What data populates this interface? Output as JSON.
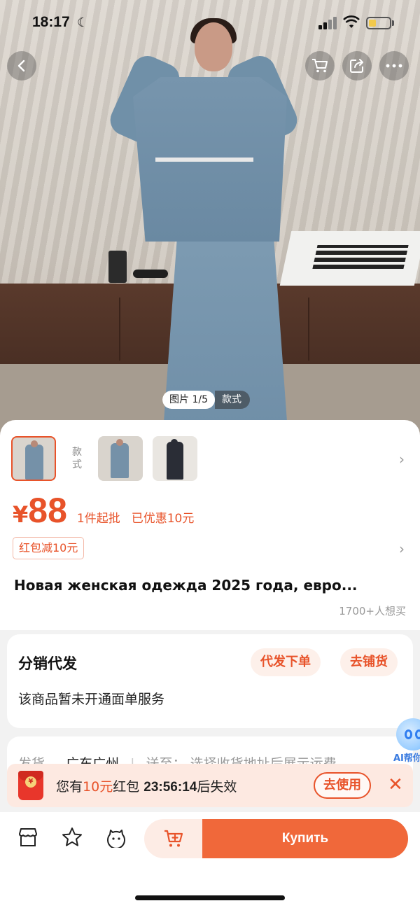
{
  "status_bar": {
    "time": "18:17"
  },
  "gallery": {
    "counter": "图片 1/5",
    "style_tab": "款式"
  },
  "thumbs": {
    "style_label": "款式"
  },
  "price": {
    "currency": "¥",
    "amount": "88",
    "min_order": "1件起批",
    "discount": "已优惠10元"
  },
  "coupon": {
    "label": "红包减10元"
  },
  "product": {
    "title": "Новая женская одежда 2025 года, евро...",
    "wants": "1700+人想买"
  },
  "distribution": {
    "title": "分销代发",
    "action_1": "代发下单",
    "action_2": "去铺货",
    "description": "该商品暂未开通面单服务"
  },
  "shipping": {
    "label": "发货",
    "origin": "广东广州",
    "dest_label": "送至：",
    "dest_hint": "选择收货地址后展示运费"
  },
  "ai_helper": {
    "label": "AI帮你"
  },
  "red_packet": {
    "prefix": "您有",
    "amount": "10元",
    "suffix": "红包",
    "countdown": "23:56:14",
    "expiry": "后失效",
    "use_label": "去使用"
  },
  "bottom_bar": {
    "buy_label": "Купить"
  },
  "colors": {
    "accent": "#e8532a",
    "buy_button": "#f0683a",
    "coupon_bg": "#fde9e1"
  }
}
